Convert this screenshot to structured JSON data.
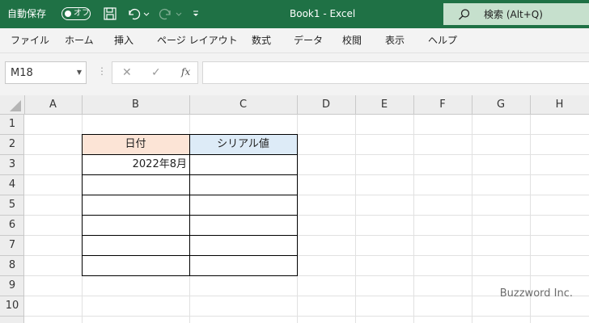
{
  "titlebar": {
    "autosave_label": "自動保存",
    "autosave_state": "オフ",
    "doc_title": "Book1 - Excel",
    "search_text": "検索 (Alt+Q)",
    "icons": [
      "save-icon",
      "undo-icon",
      "redo-icon",
      "customize-qat-icon",
      "search-icon"
    ]
  },
  "menu": [
    "ファイル",
    "ホーム",
    "挿入",
    "ページ レイアウト",
    "数式",
    "データ",
    "校閲",
    "表示",
    "ヘルプ"
  ],
  "formula_bar": {
    "name_box": "M18",
    "formula": ""
  },
  "sheet": {
    "columns": [
      "A",
      "B",
      "C",
      "D",
      "E",
      "F",
      "G",
      "H"
    ],
    "rows": [
      "1",
      "2",
      "3",
      "4",
      "5",
      "6",
      "7",
      "8",
      "9",
      "10"
    ],
    "headers": {
      "b2": "日付",
      "c2": "シリアル値"
    },
    "b3": "2022年8月",
    "header_colors": {
      "b2": "#fce4d6",
      "c2": "#ddebf7"
    }
  },
  "watermark": "Buzzword Inc.",
  "colors": {
    "titlebar": "#1f7145",
    "search_box": "#c6e0cd",
    "menubar": "#f3f3f3"
  }
}
